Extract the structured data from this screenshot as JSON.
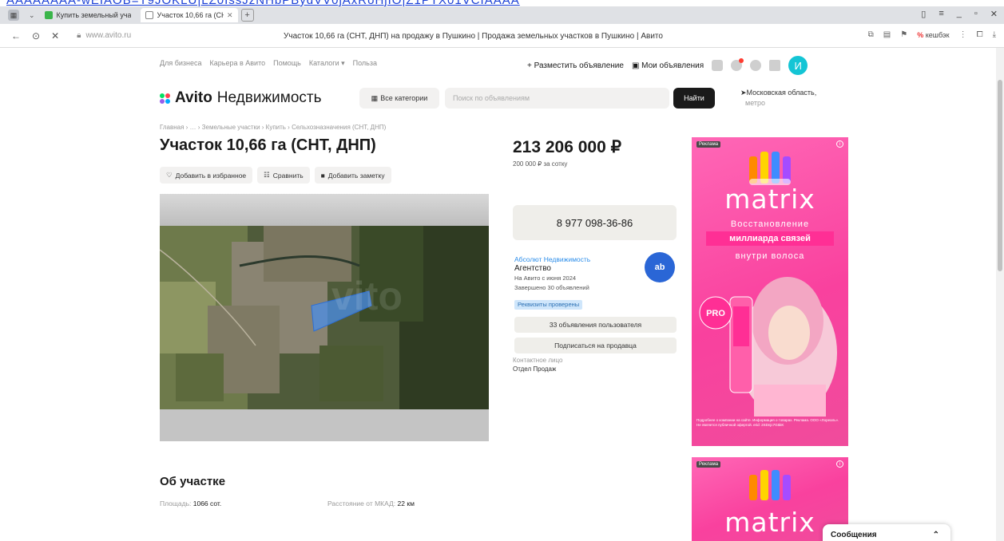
{
  "top_link": "AAAAAAAA-wEIAOB=T9JOKLU|LZ0IssJzNHbPBydVV0jAxRoHjIO|Z1PTX01VCIAAAA",
  "browser": {
    "tabs": [
      {
        "title": "Купить земельный участ",
        "fav_color": "#3ab54a",
        "active": false
      },
      {
        "title": "Участок 10,66 га (СНТ,",
        "fav_color": "#888888",
        "active": true
      }
    ],
    "url_host": "www.avito.ru",
    "page_title": "Участок 10,66 га (СНТ, ДНП) на продажу в Пушкино | Продажа земельных участков в Пушкино | Авито",
    "cashback_label": "кешбэк"
  },
  "sitenav": {
    "links": [
      "Для бизнеса",
      "Карьера в Авито",
      "Помощь",
      "Каталоги ▾",
      "Польза"
    ],
    "post_ad": "+ Разместить объявление",
    "my_ads": "Мои объявления",
    "avatar_letter": "И"
  },
  "header": {
    "logo_brand": "Avito",
    "logo_sub": "Недвижимость",
    "categories_label": "Все категории",
    "search_placeholder": "Поиск по объявлениям",
    "find_label": "Найти",
    "region": "Московская область,",
    "metro": "метро"
  },
  "listing": {
    "breadcrumb": "Главная › … › Земельные участки › Купить › Сельхозназначения (СНТ, ДНП)",
    "title": "Участок 10,66 га (СНТ, ДНП)",
    "actions": [
      "Добавить в избранное",
      "Сравнить",
      "Добавить заметку"
    ],
    "price": "213 206 000 ₽",
    "price_per": "200 000 ₽ за сотку",
    "phone": "8 977 098-36-86",
    "seller": {
      "name": "Абсолют Недвижимость",
      "type": "Агентство",
      "since": "На Авито с июня 2024",
      "completed": "Завершено 30 объявлений",
      "badge": "Реквизиты проверены",
      "logo_text": "ab"
    },
    "seller_ads_button": "33 объявления пользователя",
    "subscribe_button": "Подписаться на продавца",
    "contact_label": "Контактное лицо",
    "contact_value": "Отдел Продаж"
  },
  "about": {
    "title": "Об участке",
    "area_label": "Площадь:",
    "area_value": "1066 сот.",
    "mkad_label": "Расстояние от МКАД:",
    "mkad_value": "22 км"
  },
  "ads": {
    "label": "Реклама",
    "brand": "matrix",
    "line1": "Восстановление",
    "highlight": "миллиарда связей",
    "line2": "внутри волоса",
    "pro_badge": "PRO",
    "foot_text": "Подробнее о компании на сайте. Информация о товарах. Реклама. ООО «Лореаль». Не является публичной офертой. erid: 2SDnjc7G5kK"
  },
  "messages": {
    "label": "Сообщения"
  },
  "colors": {
    "accent_blue": "#2d8eea",
    "ad_pink": "#f9419e",
    "avatar": "#14c5d5"
  }
}
